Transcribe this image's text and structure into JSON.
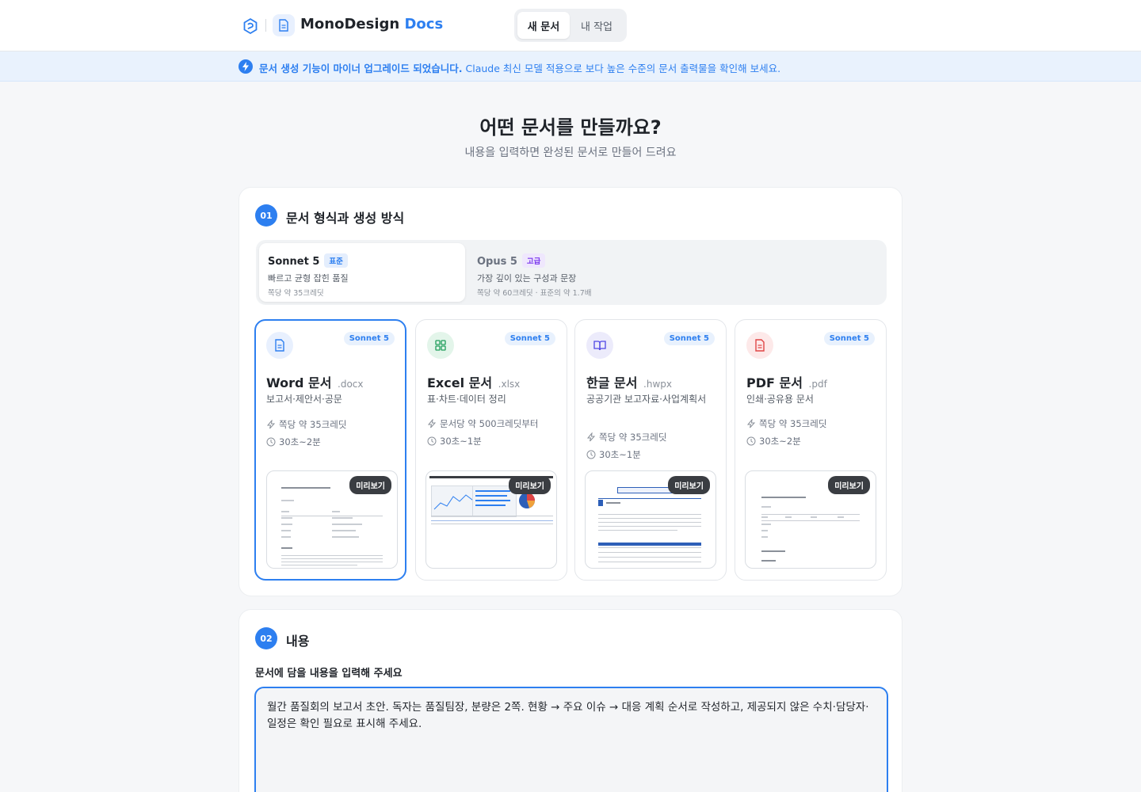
{
  "header": {
    "brand_first": "MonoDesign",
    "brand_accent": "Docs",
    "tabs": [
      {
        "label": "새 문서",
        "active": true
      },
      {
        "label": "내 작업",
        "active": false
      }
    ]
  },
  "banner": {
    "bold_text": "문서 생성 기능이 마이너 업그레이드 되었습니다.",
    "text": " Claude 최신 모델 적용으로 보다 높은 수준의 문서 출력물을 확인해 보세요."
  },
  "hero": {
    "title": "어떤 문서를 만들까요?",
    "subtitle": "내용을 입력하면 완성된 문서로 만들어 드려요"
  },
  "section1": {
    "step": "01",
    "title": "문서 형식과 생성 방식",
    "models": [
      {
        "name": "Sonnet 5",
        "tier": "표준",
        "desc": "빠르고 균형 잡힌 품질",
        "credit": "쪽당 약 35크레딧",
        "selected": true
      },
      {
        "name": "Opus 5",
        "tier": "고급",
        "desc": "가장 깊이 있는 구성과 문장",
        "credit": "쪽당 약 60크레딧 · 표준의 약 1.7배",
        "selected": false
      }
    ],
    "formats": [
      {
        "title": "Word 문서",
        "ext": ".docx",
        "desc": "보고서·제안서·공문",
        "credit": "쪽당 약 35크레딧",
        "time": "30초~2분",
        "model": "Sonnet 5",
        "preview": "미리보기",
        "selected": true
      },
      {
        "title": "Excel 문서",
        "ext": ".xlsx",
        "desc": "표·차트·데이터 정리",
        "credit": "문서당 약 500크레딧부터",
        "time": "30초~1분",
        "model": "Sonnet 5",
        "preview": "미리보기",
        "selected": false
      },
      {
        "title": "한글 문서",
        "ext": ".hwpx",
        "desc": "공공기관 보고자료·사업계획서",
        "credit": "쪽당 약 35크레딧",
        "time": "30초~1분",
        "model": "Sonnet 5",
        "preview": "미리보기",
        "selected": false
      },
      {
        "title": "PDF 문서",
        "ext": ".pdf",
        "desc": "인쇄·공유용 문서",
        "credit": "쪽당 약 35크레딧",
        "time": "30초~2분",
        "model": "Sonnet 5",
        "preview": "미리보기",
        "selected": false
      }
    ]
  },
  "section2": {
    "step": "02",
    "title": "내용",
    "label": "문서에 담을 내용을 입력해 주세요",
    "value": "월간 품질회의 보고서 초안. 독자는 품질팀장, 분량은 2쪽. 현황 → 주요 이슈 → 대응 계획 순서로 작성하고, 제공되지 않은 수치·담당자·일정은 확인 필요로 표시해 주세요."
  },
  "icons": {
    "brand": "brand-logo-icon",
    "doc": "document-icon",
    "bolt": "bolt-icon",
    "clock": "clock-icon",
    "grid": "grid-icon",
    "book": "book-icon",
    "pdf": "pdf-icon"
  },
  "colors": {
    "accent": "#2d7ff0",
    "excel": "#1e9e5a",
    "pdf": "#e04545",
    "banner_bg": "#e9f2fd"
  }
}
